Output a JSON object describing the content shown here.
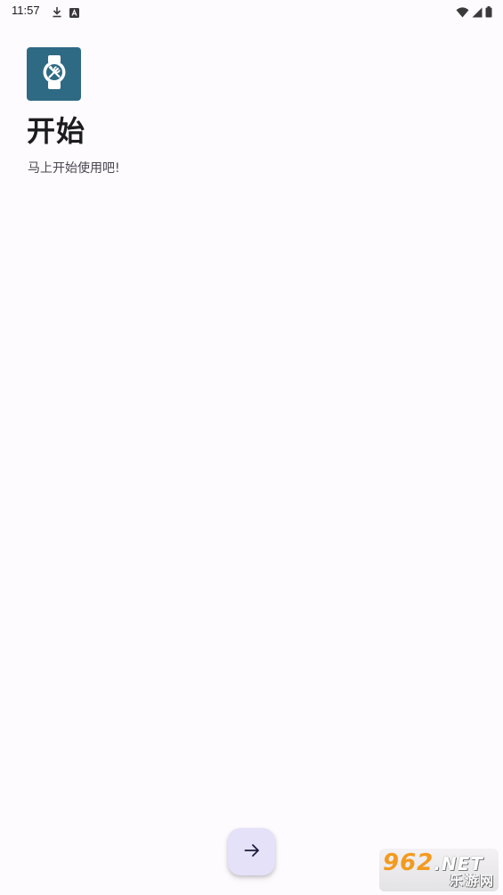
{
  "status_bar": {
    "time": "11:57",
    "left_icons": [
      "download-icon",
      "keyboard-a-icon"
    ],
    "right_icons": [
      "wifi-icon",
      "signal-icon",
      "battery-icon"
    ]
  },
  "app": {
    "icon": "watch-tools-icon",
    "icon_bg_color": "#2f6a84"
  },
  "page": {
    "title": "开始",
    "subtitle": "马上开始使用吧!"
  },
  "fab": {
    "icon": "arrow-right-icon",
    "bg_color": "#e4e1f9"
  },
  "watermark": {
    "number": "962",
    "suffix": ".NET",
    "tagline": "乐游网"
  }
}
